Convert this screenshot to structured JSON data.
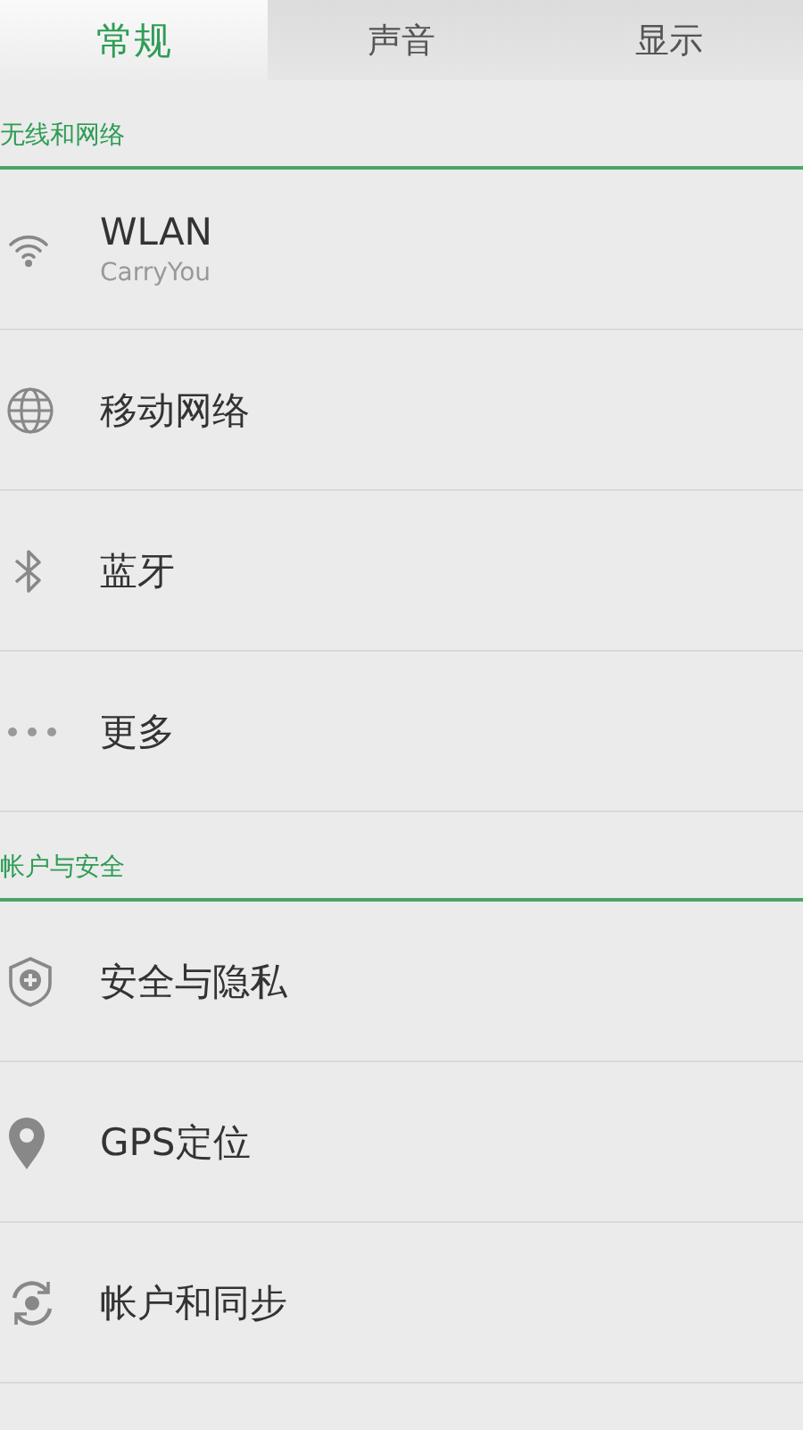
{
  "tabs": [
    {
      "label": "常规",
      "selected": true
    },
    {
      "label": "声音",
      "selected": false
    },
    {
      "label": "显示",
      "selected": false
    }
  ],
  "sections": [
    {
      "title": "无线和网络",
      "items": [
        {
          "label": "WLAN",
          "subtitle": "CarryYou"
        },
        {
          "label": "移动网络"
        },
        {
          "label": "蓝牙"
        },
        {
          "label": "更多"
        }
      ]
    },
    {
      "title": "帐户与安全",
      "items": [
        {
          "label": "安全与隐私"
        },
        {
          "label": "GPS定位"
        },
        {
          "label": "帐户和同步"
        }
      ]
    }
  ]
}
